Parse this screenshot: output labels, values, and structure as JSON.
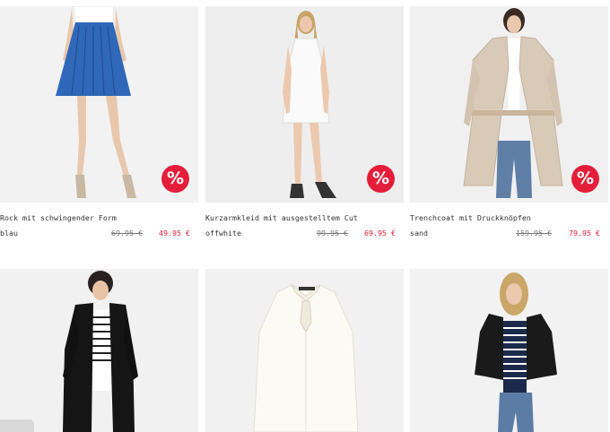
{
  "products": [
    {
      "title": "Rock mit schwingender Form",
      "color": "blau",
      "old_price": "69.95 €",
      "new_price": "49.95 €",
      "badge": "%",
      "image": "model-blue-pleated-skirt"
    },
    {
      "title": "Kurzarmkleid mit ausgestelltem Cut",
      "color": "offwhite",
      "old_price": "99.95 €",
      "new_price": "69.95 €",
      "badge": "%",
      "image": "model-white-short-dress"
    },
    {
      "title": "Trenchcoat mit Druckknöpfen",
      "color": "sand",
      "old_price": "159.95 €",
      "new_price": "79.95 €",
      "badge": "%",
      "image": "model-beige-trenchcoat"
    },
    {
      "image": "model-black-coat-striped-shirt"
    },
    {
      "image": "white-blouse-with-bow"
    },
    {
      "image": "model-leather-jacket-striped-shirt"
    }
  ],
  "colors": {
    "sale_red": "#e41e3a",
    "image_bg": "#efefef"
  },
  "icons": {
    "discount_badge": "percent-badge-icon"
  }
}
